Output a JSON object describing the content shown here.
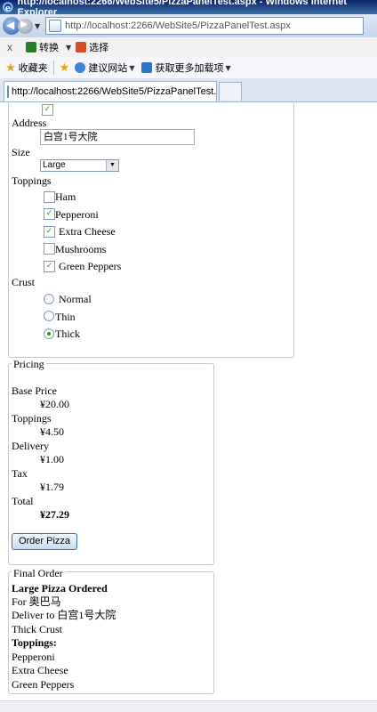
{
  "window": {
    "title": "http://localhost:2266/WebSite5/PizzaPanelTest.aspx - Windows Internet Explorer"
  },
  "address_bar": {
    "url": "http://localhost:2266/WebSite5/PizzaPanelTest.aspx"
  },
  "menu": {
    "close_glyph": "x",
    "convert_label": "转换",
    "select_label": "选择"
  },
  "favorites": {
    "favorites_label": "收藏夹",
    "suggested_sites_label": "建议网站",
    "addons_label": "获取更多加载项"
  },
  "tabs": [
    {
      "label": "http://localhost:2266/WebSite5/PizzaPanelTest..."
    }
  ],
  "order_form": {
    "top_checkbox_checked": true,
    "address_label": "Address",
    "address_value": "白宫1号大院",
    "size_label": "Size",
    "size_value": "Large",
    "toppings_label": "Toppings",
    "toppings": [
      {
        "label": "Ham",
        "checked": false
      },
      {
        "label": "Pepperoni",
        "checked": true
      },
      {
        "label": "Extra Cheese",
        "checked": true
      },
      {
        "label": "Mushrooms",
        "checked": false
      },
      {
        "label": "Green Peppers",
        "checked": true
      }
    ],
    "crust_label": "Crust",
    "crusts": [
      {
        "label": "Normal",
        "selected": false
      },
      {
        "label": "Thin",
        "selected": false
      },
      {
        "label": "Thick",
        "selected": true
      }
    ]
  },
  "pricing": {
    "legend": "Pricing",
    "base_price_label": "Base Price",
    "base_price": "¥20.00",
    "toppings_label": "Toppings",
    "toppings": "¥4.50",
    "delivery_label": "Delivery",
    "delivery": "¥1.00",
    "tax_label": "Tax",
    "tax": "¥1.79",
    "total_label": "Total",
    "total": "¥27.29",
    "order_button": "Order Pizza"
  },
  "final_order": {
    "legend": "Final Order",
    "heading": "Large Pizza Ordered",
    "for_line": "For 奥巴马",
    "deliver_line": "Deliver to 白宫1号大院",
    "crust_line": "Thick Crust",
    "toppings_heading": "Toppings:",
    "toppings": [
      "Pepperoni",
      "Extra Cheese",
      "Green Peppers"
    ]
  },
  "colors": {
    "check": "#21a121",
    "titlebar": "#0a246a"
  }
}
